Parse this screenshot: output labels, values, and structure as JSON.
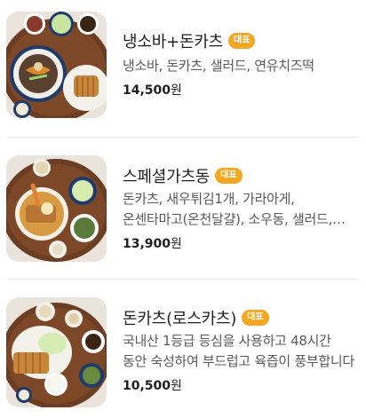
{
  "menu": {
    "items": [
      {
        "name": "냉소바+돈카츠",
        "badge": "대표",
        "description": "냉소바, 돈카츠, 샐러드, 연유치즈떡",
        "price": "14,500",
        "currency": "원",
        "image": "naengsoba-donkatsu-set-photo"
      },
      {
        "name": "스페셜가츠동",
        "badge": "대표",
        "description": "돈카츠, 새우튀김1개, 가라아게, 온센타마고(온천달걀), 소우동, 샐러드, 연유치즈떡",
        "price": "13,900",
        "currency": "원",
        "image": "special-katsudon-set-photo"
      },
      {
        "name": "돈카츠(로스카츠)",
        "badge": "대표",
        "description": "국내산 1등급 등심을 사용하고 48시간 동안 숙성하여 부드럽고 육즙이 풍부합니다",
        "price": "10,500",
        "currency": "원",
        "image": "rosukatsu-set-photo"
      }
    ]
  },
  "colors": {
    "badge": "#f5a623",
    "price": "#1f1f1f",
    "description": "#5a5a5a",
    "divider": "#ececec"
  }
}
